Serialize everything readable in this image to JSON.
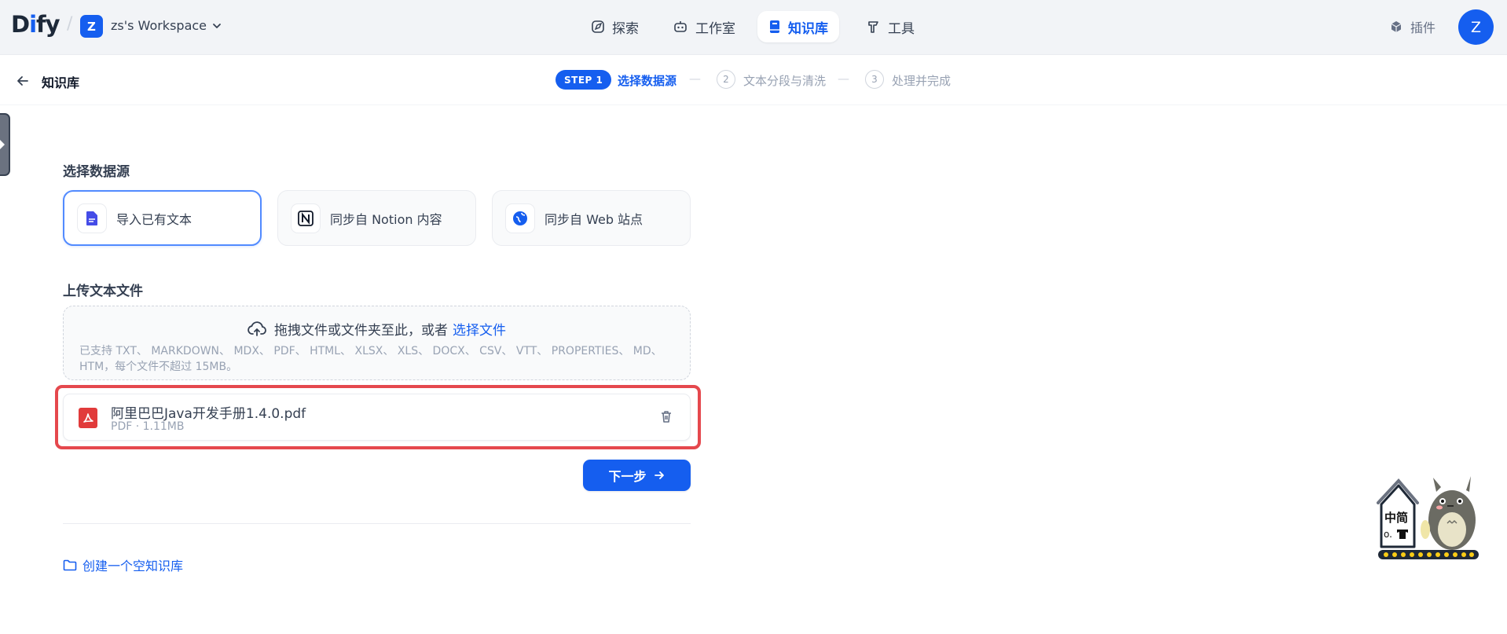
{
  "topbar": {
    "logo_main": "D",
    "logo_accent": "i",
    "logo_rest": "fy",
    "workspace_initial": "Z",
    "workspace_name": "zs's Workspace",
    "nav": [
      {
        "label": "探索",
        "icon": "compass-icon"
      },
      {
        "label": "工作室",
        "icon": "robot-icon"
      },
      {
        "label": "知识库",
        "icon": "book-icon",
        "active": true
      },
      {
        "label": "工具",
        "icon": "hammer-icon"
      }
    ],
    "plugin_label": "插件",
    "user_initial": "Z"
  },
  "subheader": {
    "title": "知识库",
    "step1_badge": "STEP 1",
    "step1_label": "选择数据源",
    "step2_num": "2",
    "step2_label": "文本分段与清洗",
    "step3_num": "3",
    "step3_label": "处理并完成",
    "dash": "—"
  },
  "datasource": {
    "title": "选择数据源",
    "options": [
      {
        "label": "导入已有文本",
        "icon": "file-text-icon",
        "active": true
      },
      {
        "label": "同步自 Notion 内容",
        "icon": "notion-icon"
      },
      {
        "label": "同步自 Web 站点",
        "icon": "globe-icon"
      }
    ]
  },
  "upload": {
    "title": "上传文本文件",
    "drop_text": "拖拽文件或文件夹至此，或者",
    "drop_link": "选择文件",
    "supported": "已支持 TXT、 MARKDOWN、 MDX、 PDF、 HTML、 XLSX、 XLS、 DOCX、 CSV、 VTT、 PROPERTIES、 MD、 HTM，每个文件不超过 15MB。"
  },
  "file": {
    "name": "阿里巴巴Java开发手册1.4.0.pdf",
    "meta": "PDF · 1.11MB"
  },
  "actions": {
    "next_label": "下一步",
    "create_empty_label": "创建一个空知识库"
  },
  "mascot_text": {
    "line1": "中简",
    "line2": "o."
  },
  "colors": {
    "primary": "#155eef",
    "highlight": "#e5484d",
    "pdf": "#e13b3b"
  }
}
